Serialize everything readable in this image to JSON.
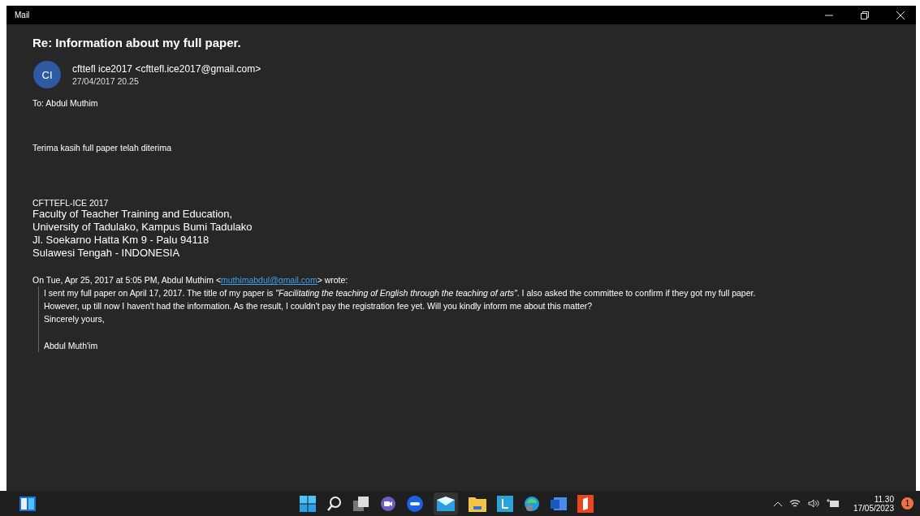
{
  "window": {
    "title": "Mail"
  },
  "message": {
    "subject": "Re: Information about my full paper.",
    "avatar_initials": "CI",
    "sender": "cfttefl ice2017 <cfttefl.ice2017@gmail.com>",
    "date": "27/04/2017 20.25",
    "to": "To: Abdul Muthim",
    "body": "Terima kasih full paper telah diterima",
    "signature_title": "CFTTEFL-ICE 2017",
    "signature_lines": [
      "Faculty of Teacher Training and Education,",
      "University of Tadulako, Kampus Bumi Tadulako",
      "Jl. Soekarno Hatta Km 9 - Palu 94118",
      "Sulawesi Tengah - INDONESIA"
    ],
    "quote_intro_before": "On Tue, Apr 25, 2017 at 5:05 PM, Abdul Muthim <",
    "quote_intro_link": "muthimabdul@gmail.com",
    "quote_intro_after": "> wrote:",
    "quote_lines": [
      "I sent my full paper on April 17, 2017. The title of my paper is *\"Facilitating the teaching of English through the teaching of arts\"*. I also asked the committee to confirm if they got my full paper.",
      "However, up till now I haven't had the information. As the result, I couldn't pay the registration fee yet. Will you kindly inform me about this matter?",
      "Sincerely yours,"
    ],
    "quote_signoff": "Abdul Muth'im"
  },
  "taskbar": {
    "time": "11.30",
    "date": "17/05/2023",
    "notification_count": "1"
  }
}
